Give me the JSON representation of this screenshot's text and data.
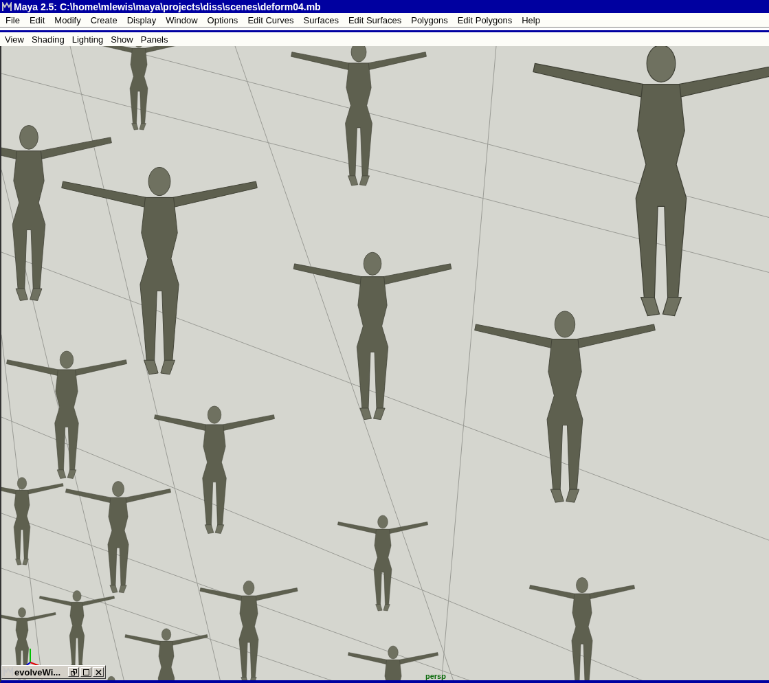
{
  "window": {
    "title": "Maya 2.5: C:\\home\\mlewis\\maya\\projects\\diss\\scenes\\deform04.mb"
  },
  "menu_bar": [
    "File",
    "Edit",
    "Modify",
    "Create",
    "Display",
    "Window",
    "Options",
    "Edit Curves",
    "Surfaces",
    "Edit Surfaces",
    "Polygons",
    "Edit Polygons",
    "Help"
  ],
  "panel_menu": [
    "View",
    "Shading",
    "Lighting",
    "Show",
    "Panels"
  ],
  "viewport": {
    "camera_label": "persp"
  },
  "minimized_window": {
    "title": "evolveWi..."
  }
}
